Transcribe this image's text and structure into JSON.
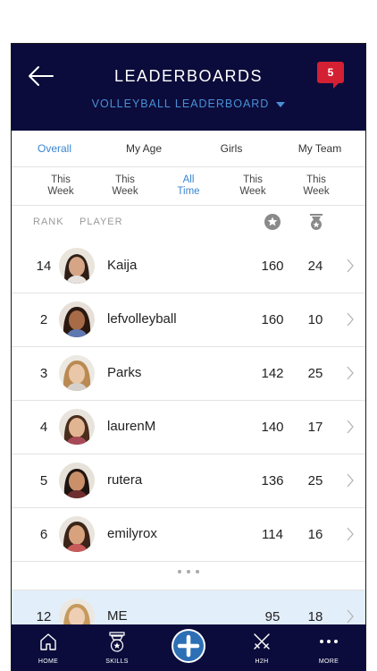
{
  "header": {
    "title": "LEADERBOARDS",
    "subtitle": "VOLLEYBALL LEADERBOARD",
    "notification_count": "5"
  },
  "filters": [
    {
      "label": "Overall",
      "active": true
    },
    {
      "label": "My Age",
      "active": false
    },
    {
      "label": "Girls",
      "active": false
    },
    {
      "label": "My Team",
      "active": false
    }
  ],
  "periods": [
    {
      "line1": "This",
      "line2": "Week",
      "active": false
    },
    {
      "line1": "This",
      "line2": "Week",
      "active": false
    },
    {
      "line1": "All",
      "line2": "Time",
      "active": true
    },
    {
      "line1": "This",
      "line2": "Week",
      "active": false
    },
    {
      "line1": "This",
      "line2": "Week",
      "active": false
    }
  ],
  "columns": {
    "rank": "RANK",
    "player": "PLAYER",
    "points_icon": "star-circle-icon",
    "badges_icon": "medal-icon"
  },
  "rows": [
    {
      "rank": "14",
      "name": "Kaija",
      "points": "160",
      "badges": "24"
    },
    {
      "rank": "2",
      "name": "lefvolleyball",
      "points": "160",
      "badges": "10"
    },
    {
      "rank": "3",
      "name": "Parks",
      "points": "142",
      "badges": "25"
    },
    {
      "rank": "4",
      "name": "laurenM",
      "points": "140",
      "badges": "17"
    },
    {
      "rank": "5",
      "name": "rutera",
      "points": "136",
      "badges": "25"
    },
    {
      "rank": "6",
      "name": "emilyrox",
      "points": "114",
      "badges": "16"
    }
  ],
  "me_row": {
    "rank": "12",
    "name": "ME",
    "points": "95",
    "badges": "18"
  },
  "tabbar": {
    "home": "HOME",
    "skills": "SKILLS",
    "h2h": "H2H",
    "more": "MORE"
  },
  "colors": {
    "navy": "#0b0c3b",
    "accent": "#3a86d0",
    "badge": "#d42033",
    "me_bg": "#e2eef9"
  }
}
